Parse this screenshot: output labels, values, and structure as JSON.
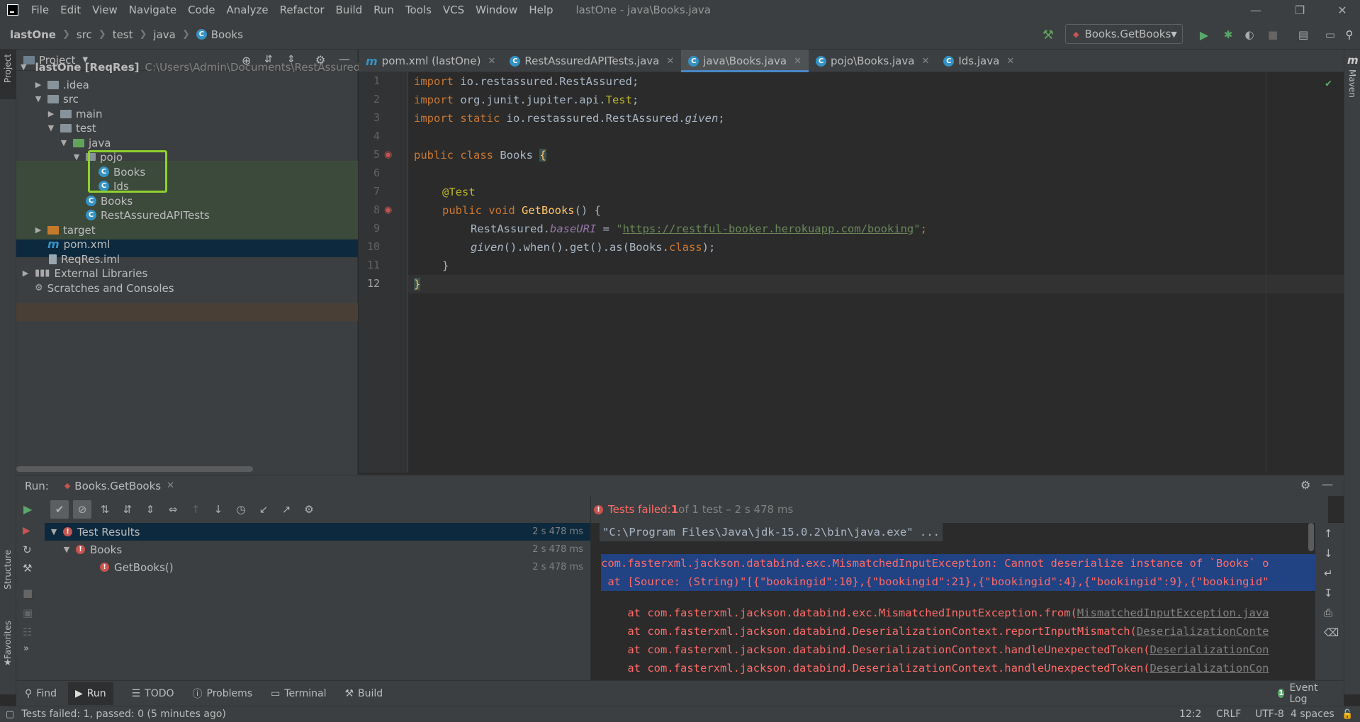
{
  "window": {
    "title": "lastOne - java\\Books.java"
  },
  "menu": [
    "File",
    "Edit",
    "View",
    "Navigate",
    "Code",
    "Analyze",
    "Refactor",
    "Build",
    "Run",
    "Tools",
    "VCS",
    "Window",
    "Help"
  ],
  "breadcrumb": [
    "lastOne",
    "src",
    "test",
    "java",
    "Books"
  ],
  "run_config": "Books.GetBooks",
  "left_strip": {
    "project": "Project",
    "structure": "Structure",
    "favorites": "Favorites"
  },
  "right_strip": {
    "maven": "Maven"
  },
  "project_panel": {
    "title": "Project",
    "tree": [
      {
        "label": "lastOne [ReqRes]",
        "hint": "C:\\Users\\Admin\\Documents\\RestAssuredProje"
      },
      {
        "label": ".idea"
      },
      {
        "label": "src"
      },
      {
        "label": "main"
      },
      {
        "label": "test"
      },
      {
        "label": "java"
      },
      {
        "label": "pojo"
      },
      {
        "label": "Books"
      },
      {
        "label": "Ids"
      },
      {
        "label": "Books"
      },
      {
        "label": "RestAssuredAPITests"
      },
      {
        "label": "target"
      },
      {
        "label": "pom.xml"
      },
      {
        "label": "ReqRes.iml"
      },
      {
        "label": "External Libraries"
      },
      {
        "label": "Scratches and Consoles"
      }
    ]
  },
  "editor_tabs": [
    {
      "label": "pom.xml (lastOne)",
      "icon": "maven-icon"
    },
    {
      "label": "RestAssuredAPITests.java",
      "icon": "class-icon"
    },
    {
      "label": "java\\Books.java",
      "icon": "class-icon",
      "active": true
    },
    {
      "label": "pojo\\Books.java",
      "icon": "class-icon"
    },
    {
      "label": "Ids.java",
      "icon": "class-icon"
    }
  ],
  "code": {
    "line_numbers": [
      "1",
      "2",
      "3",
      "4",
      "5",
      "6",
      "7",
      "8",
      "9",
      "10",
      "11",
      "12"
    ],
    "l1_kw": "import",
    "l1_rest": " io.restassured.RestAssured;",
    "l2_kw": "import",
    "l2_rest": " org.junit.jupiter.api.",
    "l2_test": "Test",
    "l2_end": ";",
    "l3_kw": "import static",
    "l3_rest": " io.restassured.RestAssured.",
    "l3_given": "given",
    "l3_end": ";",
    "l5_kw": "public class",
    "l5_name": " Books ",
    "l5_brace": "{",
    "l7_ann": "@Test",
    "l8_kw": "public void",
    "l8_fn": " GetBooks",
    "l8_rest": "() {",
    "l9_a": "RestAssured.",
    "l9_field": "baseURI",
    "l9_eq": " = ",
    "l9_q1": "\"",
    "l9_url": "https://restful-booker.herokuapp.com/booking",
    "l9_q2": "\"",
    "l9_end": ";",
    "l10_given": "given",
    "l10_rest": "().when().get().as(Books.",
    "l10_kw": "class",
    "l10_end": ");",
    "l11": "}",
    "l12": "}"
  },
  "run_panel": {
    "label": "Run:",
    "tab": "Books.GetBooks",
    "status_prefix": "Tests failed: ",
    "status_count": "1",
    "status_rest": " of 1 test – 2 s 478 ms",
    "results": [
      {
        "label": "Test Results",
        "time": "2 s 478 ms"
      },
      {
        "label": "Books",
        "time": "2 s 478 ms"
      },
      {
        "label": "GetBooks()",
        "time": "2 s 478 ms"
      }
    ]
  },
  "console": {
    "l1": "\"C:\\Program Files\\Java\\jdk-15.0.2\\bin\\java.exe\" ...",
    "l2": "com.fasterxml.jackson.databind.exc.MismatchedInputException: Cannot deserialize instance of `Books` o",
    "l3": " at [Source: (String)\"[{\"bookingid\":10},{\"bookingid\":21},{\"bookingid\":4},{\"bookingid\":9},{\"bookingid\"",
    "l4a": "    at com.fasterxml.jackson.databind.exc.MismatchedInputException.from(",
    "l4b": "MismatchedInputException.java",
    "l5a": "    at com.fasterxml.jackson.databind.DeserializationContext.reportInputMismatch(",
    "l5b": "DeserializationConte",
    "l6a": "    at com.fasterxml.jackson.databind.DeserializationContext.handleUnexpectedToken(",
    "l6b": "DeserializationCon",
    "l7a": "    at com.fasterxml.jackson.databind.DeserializationContext.handleUnexpectedToken(",
    "l7b": "DeserializationCon"
  },
  "bottom_tabs": [
    "Find",
    "Run",
    "TODO",
    "Problems",
    "Terminal",
    "Build"
  ],
  "event_log": "Event Log",
  "status": {
    "message": "Tests failed: 1, passed: 0 (5 minutes ago)",
    "position": "12:2",
    "line_sep": "CRLF",
    "encoding": "UTF-8",
    "indent": "4 spaces"
  }
}
